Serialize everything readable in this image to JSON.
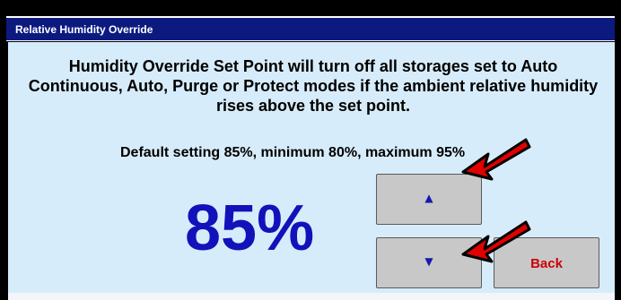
{
  "window": {
    "title": "Relative Humidity Override"
  },
  "main": {
    "description": "Humidity Override Set Point will turn off all storages set to Auto Continuous, Auto, Purge or Protect modes if the ambient relative humidity rises above the set point.",
    "defaults_text": "Default setting 85%, minimum 80%, maximum 95%",
    "current_value": "85%"
  },
  "buttons": {
    "increase_glyph": "▲",
    "decrease_glyph": "▼",
    "back_label": "Back"
  },
  "icons": {
    "increase": "triangle-up-icon",
    "decrease": "triangle-down-icon",
    "annotation": "red-arrow-icon"
  },
  "colors": {
    "titlebar": "#0c1a80",
    "background": "#d7ecfa",
    "value": "#1212bb",
    "back_label": "#cc0000",
    "annotation_arrow": "#e00000"
  }
}
